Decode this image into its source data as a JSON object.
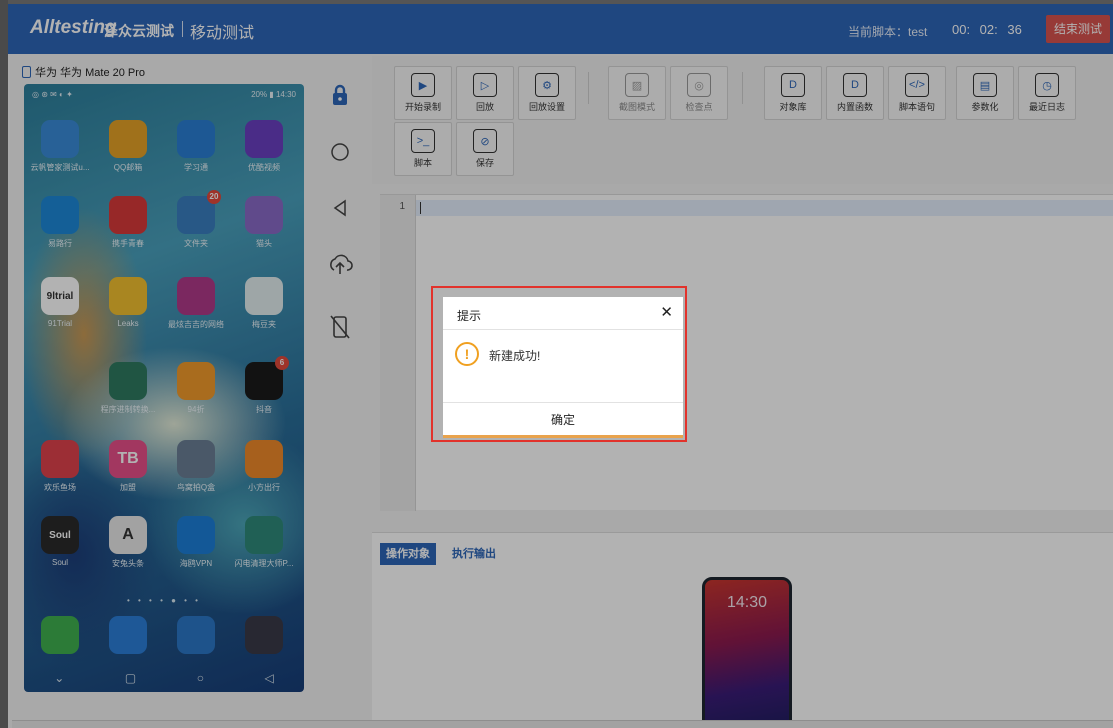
{
  "header": {
    "logo": "Alltesting",
    "logo_sub": "泽众云测试",
    "module_title": "移动测试",
    "current_script": "当前脚本：test",
    "timer": "00: 02: 36",
    "end_button": "结束测试"
  },
  "device": {
    "title": "华为 华为 Mate 20 Pro",
    "status_left": "◎ ⊛ ✉ ◐ ✦",
    "status_right": "20% ▮ 14:30",
    "apps": [
      {
        "label": "云帆管家测试u...",
        "icon": "bear-icon",
        "color": "#3a8bd8"
      },
      {
        "label": "QQ邮箱",
        "icon": "mail-icon",
        "color": "#e6a228"
      },
      {
        "label": "学习通",
        "icon": "cap-icon",
        "color": "#2a7fd5"
      },
      {
        "label": "优酷视频",
        "icon": "six-icon",
        "color": "#6a3fc2"
      },
      {
        "label": "易路行",
        "icon": "diamond-icon",
        "color": "#1d89d9"
      },
      {
        "label": "携手青春",
        "icon": "star-icon",
        "color": "#d93a3a"
      },
      {
        "label": "文件夹",
        "icon": "folder-icon",
        "color": "#3a7ec0",
        "badge": "20"
      },
      {
        "label": "猫头",
        "icon": "cat-icon",
        "color": "#8a6bc8"
      },
      {
        "label": "91Trial",
        "icon": "trial-icon",
        "color": "#ffffff",
        "text": "9ltrial"
      },
      {
        "label": "Leaks",
        "icon": "bird-icon",
        "color": "#f2c030"
      },
      {
        "label": "最炫吉吉的网络",
        "icon": "anime-icon",
        "color": "#b03a8a"
      },
      {
        "label": "梅豆夹",
        "icon": "leaf-icon",
        "color": "#e2eef0"
      },
      {
        "label": "",
        "icon": "none",
        "color": "transparent"
      },
      {
        "label": "程序进制转换...",
        "icon": "calculator-icon",
        "color": "#2f7a60"
      },
      {
        "label": "94折",
        "icon": "coupon-icon",
        "color": "#f29b2b"
      },
      {
        "label": "抖音",
        "icon": "tiktok-icon",
        "color": "#1a1a1a",
        "badge": "6"
      },
      {
        "label": "欢乐鱼场",
        "icon": "aperture-icon",
        "color": "#e0434d"
      },
      {
        "label": "加盟",
        "icon": "tb-icon",
        "color": "#e8508a",
        "text": "TB"
      },
      {
        "label": "鸟窝拍Q盒",
        "icon": "chat-bubble-icon",
        "color": "#6a7f95"
      },
      {
        "label": "小方出行",
        "icon": "car-icon",
        "color": "#f08a2a"
      },
      {
        "label": "Soul",
        "icon": "soul-icon",
        "color": "#2a2a2a",
        "text": "Soul"
      },
      {
        "label": "安兔头条",
        "icon": "a-icon",
        "color": "#e8e8e8",
        "text": "A"
      },
      {
        "label": "海鸥VPN",
        "icon": "seagull-icon",
        "color": "#1c7fd8"
      },
      {
        "label": "闪电清理大师P...",
        "icon": "globe-icon",
        "color": "#2f8a7a"
      }
    ],
    "dock": [
      {
        "icon": "phone-icon",
        "color": "#3fb04f"
      },
      {
        "icon": "message-icon",
        "color": "#2b7fd9"
      },
      {
        "icon": "browser-icon",
        "color": "#2c78c8"
      },
      {
        "icon": "camera-icon",
        "color": "#3a3a48"
      }
    ],
    "page_dots": "• • • • ● • •"
  },
  "side_controls": [
    "lock-icon",
    "circle-home-icon",
    "back-triangle-icon",
    "cloud-upload-icon",
    "no-phone-icon"
  ],
  "toolbar": {
    "buttons": [
      {
        "label": "开始录制",
        "icon": "record-icon",
        "glyph": "▶",
        "dim": false
      },
      {
        "label": "回放",
        "icon": "playback-icon",
        "glyph": "▷",
        "dim": false
      },
      {
        "label": "回放设置",
        "icon": "settings-gear-icon",
        "glyph": "⚙",
        "dim": false
      },
      {
        "label": "截图模式",
        "icon": "image-icon",
        "glyph": "▨",
        "dim": true
      },
      {
        "label": "检查点",
        "icon": "checkpoint-shield-icon",
        "glyph": "◎",
        "dim": true
      },
      {
        "label": "对象库",
        "icon": "object-lib-icon",
        "glyph": "D",
        "dim": false
      },
      {
        "label": "内置函数",
        "icon": "builtin-func-icon",
        "glyph": "D",
        "dim": false
      },
      {
        "label": "脚本语句",
        "icon": "code-icon",
        "glyph": "</>",
        "dim": false
      },
      {
        "label": "参数化",
        "icon": "param-icon",
        "glyph": "▤",
        "dim": false
      },
      {
        "label": "最近日志",
        "icon": "log-icon",
        "glyph": "◷",
        "dim": false
      },
      {
        "label": "脚本",
        "icon": "terminal-icon",
        "glyph": ">_",
        "dim": false
      },
      {
        "label": "保存",
        "icon": "save-icon",
        "glyph": "⊘",
        "dim": false
      }
    ]
  },
  "editor": {
    "line_number": "1"
  },
  "bottom_panel": {
    "tabs": [
      "操作对象",
      "执行输出"
    ],
    "mini_phone_time": "14:30"
  },
  "dialog": {
    "title": "提示",
    "close_glyph": "✕",
    "message": "新建成功!",
    "confirm_label": "确定"
  },
  "colors": {
    "header_blue": "#2d66b8",
    "end_button_red": "#d9534f",
    "highlight_red": "#e2322b",
    "warning_orange": "#f0a020"
  }
}
